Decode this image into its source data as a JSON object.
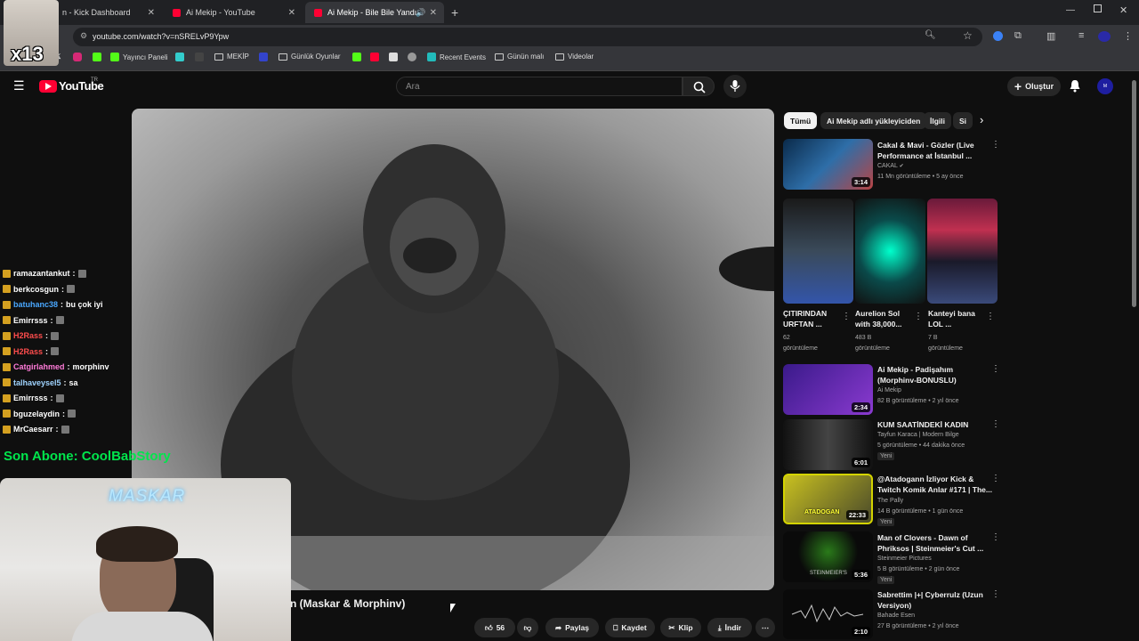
{
  "browser": {
    "tabs": [
      {
        "title": "n - Kick Dashboard",
        "active": false
      },
      {
        "title": "Ai Mekip - YouTube",
        "active": false
      },
      {
        "title": "Ai Mekip - Bile Bile Yandı Yü",
        "active": true
      }
    ],
    "url": "youtube.com/watch?v=nSRELvP9Ypw",
    "bookmarks": [
      "Yayıncı Paneli",
      "MEKİP",
      "Günlük Oyunlar",
      "Recent Events",
      "Günün malı",
      "Videolar"
    ]
  },
  "stream_overlay": {
    "counter_badge": "x13",
    "chat": [
      {
        "user": "ramazantankut",
        "msg": "",
        "color": "#ffffff"
      },
      {
        "user": "berkcosgun",
        "msg": "",
        "color": "#ffffff"
      },
      {
        "user": "batuhanc38",
        "msg": "bu çok iyi",
        "color": "#4aa8ff"
      },
      {
        "user": "Emirrsss",
        "msg": "",
        "color": "#ffffff"
      },
      {
        "user": "H2Rass",
        "msg": "",
        "color": "#ff4d4d"
      },
      {
        "user": "H2Rass",
        "msg": "",
        "color": "#ff4d4d"
      },
      {
        "user": "Catgirlahmed",
        "msg": "morphinv",
        "color": "#ff7bd9"
      },
      {
        "user": "talhaveysel5",
        "msg": "sa",
        "color": "#a0d4ff"
      },
      {
        "user": "Emirrsss",
        "msg": "",
        "color": "#ffffff"
      },
      {
        "user": "bguzelaydin",
        "msg": "",
        "color": "#ffffff"
      },
      {
        "user": "MrCaesarr",
        "msg": "",
        "color": "#ffffff"
      }
    ],
    "last_subscriber": "Son Abone: CoolBabStory",
    "webcam_sign": "MASKAR"
  },
  "youtube": {
    "logo_text": "YouTube",
    "logo_sup": "TR",
    "search_placeholder": "Ara",
    "create_label": "Oluştur",
    "video_title_partial": "n (Maskar & Morphinv)",
    "actions": {
      "likes": "56",
      "share": "Paylaş",
      "save": "Kaydet",
      "clip": "Klip",
      "download": "İndir"
    },
    "chips": [
      "Tümü",
      "Ai Mekip adlı yükleyiciden",
      "İlgili",
      "Si"
    ]
  },
  "recommendations": {
    "first": {
      "title1": "Cakal & Mavi - Gözler (Live",
      "title2": "Performance at İstanbul ...",
      "channel": "CAKAL",
      "meta": "11 Mn görüntüleme • 5 ay önce",
      "duration": "3:14"
    },
    "shorts": [
      {
        "title1": "ÇITIRINDAN",
        "title2": "URFTAN ...",
        "meta1": "62",
        "meta2": "görüntüleme"
      },
      {
        "title1": "Aurelion Sol",
        "title2": "with 38,000...",
        "meta1": "483 B",
        "meta2": "görüntüleme"
      },
      {
        "title1": "Kanteyi bana",
        "title2": "LOL ...",
        "meta1": "7 B",
        "meta2": "görüntüleme"
      }
    ],
    "list": [
      {
        "title1": "Ai Mekip - Padişahım",
        "title2": "(Morphinv-BONUSLU)",
        "channel": "Ai Mekip",
        "meta": "82 B görüntüleme • 2 yıl önce",
        "duration": "2:34",
        "new": ""
      },
      {
        "title1": "KUM SAATİNDEKİ KADIN",
        "title2": "",
        "channel": "Tayfun Karaca | Modern Bilge",
        "meta": "5 görüntüleme • 44 dakika önce",
        "duration": "6:01",
        "new": "Yeni"
      },
      {
        "title1": "@Atadogann İzliyor Kick &",
        "title2": "Twitch Komik Anlar #171 | The...",
        "channel": "The Pally",
        "meta": "14 B görüntüleme • 1 gün önce",
        "duration": "22:33",
        "new": "Yeni"
      },
      {
        "title1": "Man of Clovers - Dawn of",
        "title2": "Phriksos | Steinmeier's Cut ...",
        "channel": "Steinmeier Pictures",
        "meta": "5 B görüntüleme • 2 gün önce",
        "duration": "5:36",
        "new": "Yeni"
      },
      {
        "title1": "Sabrettim |+| Cyberrulz (Uzun",
        "title2": "Versiyon)",
        "channel": "Bahade Esen",
        "meta": "27 B görüntüleme • 2 yıl önce",
        "duration": "2:10",
        "new": ""
      }
    ],
    "thumb_labels": {
      "atadogan": "ATADOGAN",
      "steinmeier": "STEINMEIER'S"
    }
  }
}
